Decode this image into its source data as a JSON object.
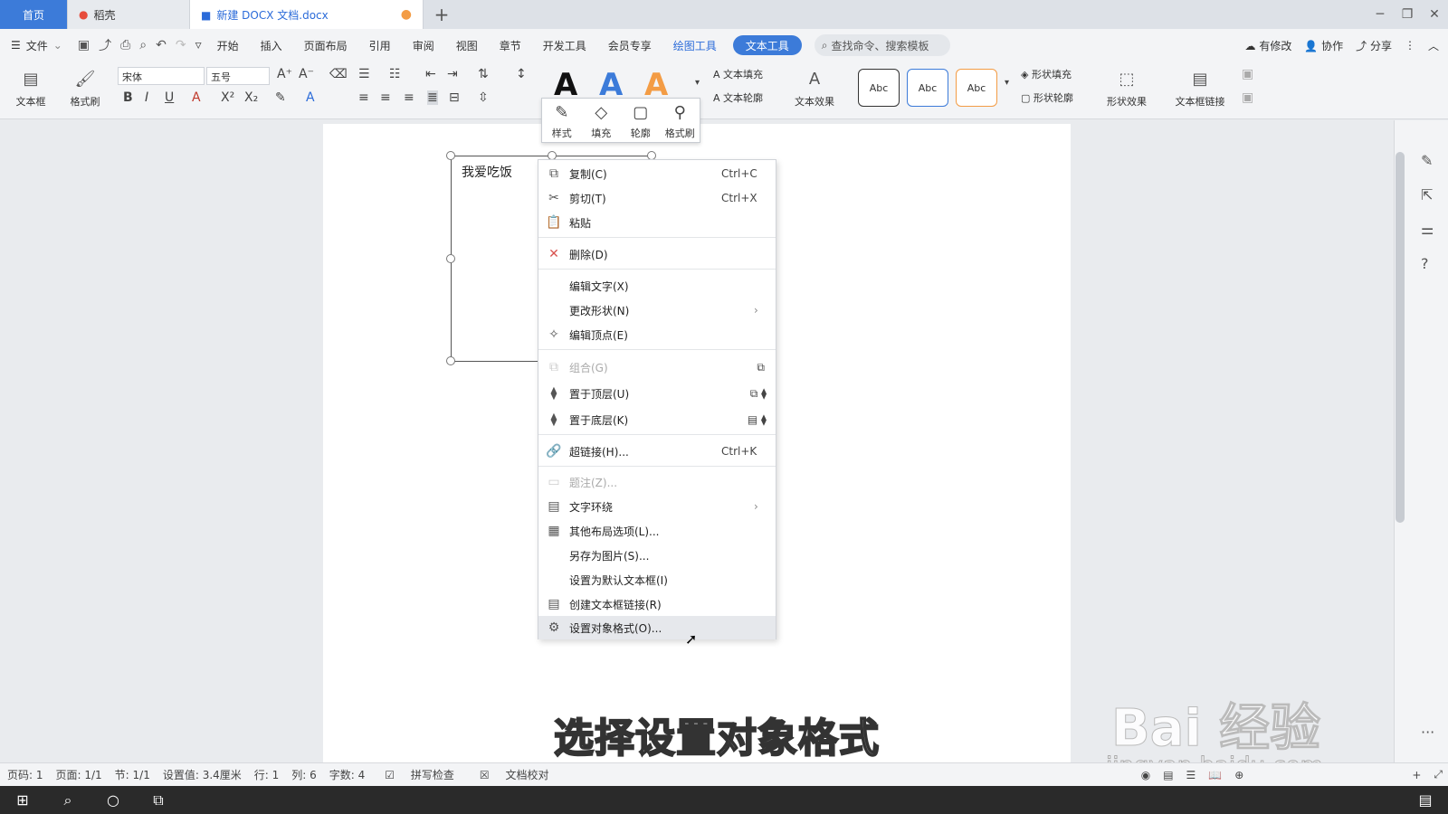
{
  "tabs": {
    "home": "首页",
    "daoke": "稻壳",
    "doc": "新建 DOCX 文档.docx"
  },
  "menubar": {
    "file": "文件",
    "items": [
      "开始",
      "插入",
      "页面布局",
      "引用",
      "审阅",
      "视图",
      "章节",
      "开发工具",
      "会员专享"
    ],
    "draw_tools": "绘图工具",
    "text_tools": "文本工具",
    "search_placeholder": "查找命令、搜索模板",
    "has_changes": "有修改",
    "collab": "协作",
    "share": "分享"
  },
  "ribbon": {
    "textbox": "文本框",
    "format_painter": "格式刷",
    "font_name": "宋体",
    "font_size": "五号",
    "text_fill": "文本填充",
    "text_outline": "文本轮廓",
    "text_effect": "文本效果",
    "abc": "Abc",
    "shape_fill": "形状填充",
    "shape_outline": "形状轮廓",
    "shape_effect": "形状效果",
    "textbox_link": "文本框链接",
    "bigA": "A"
  },
  "float_toolbar": {
    "style": "样式",
    "fill": "填充",
    "outline": "轮廓",
    "painter": "格式刷"
  },
  "textbox_content": "我爱吃饭",
  "context_menu": {
    "copy": {
      "label": "复制(C)",
      "shortcut": "Ctrl+C"
    },
    "cut": {
      "label": "剪切(T)",
      "shortcut": "Ctrl+X"
    },
    "paste": {
      "label": "粘贴"
    },
    "delete": {
      "label": "删除(D)"
    },
    "edit_text": {
      "label": "编辑文字(X)"
    },
    "change_shape": {
      "label": "更改形状(N)"
    },
    "edit_points": {
      "label": "编辑顶点(E)"
    },
    "group": {
      "label": "组合(G)"
    },
    "bring_front": {
      "label": "置于顶层(U)"
    },
    "send_back": {
      "label": "置于底层(K)"
    },
    "hyperlink": {
      "label": "超链接(H)...",
      "shortcut": "Ctrl+K"
    },
    "caption": {
      "label": "题注(Z)..."
    },
    "text_wrap": {
      "label": "文字环绕"
    },
    "layout_options": {
      "label": "其他布局选项(L)..."
    },
    "save_as_image": {
      "label": "另存为图片(S)..."
    },
    "set_default": {
      "label": "设置为默认文本框(I)"
    },
    "create_link": {
      "label": "创建文本框链接(R)"
    },
    "format_object": {
      "label": "设置对象格式(O)..."
    }
  },
  "subtitle": "选择设置对象格式",
  "watermark": {
    "logo": "Bai 经验",
    "url": "jingyan.baidu.com"
  },
  "status": {
    "page": "页码: 1",
    "pages": "页面: 1/1",
    "section": "节: 1/1",
    "setting": "设置值: 3.4厘米",
    "row": "行: 1",
    "col": "列: 6",
    "words": "字数: 4",
    "spell": "拼写检查",
    "proof": "文档校对"
  }
}
